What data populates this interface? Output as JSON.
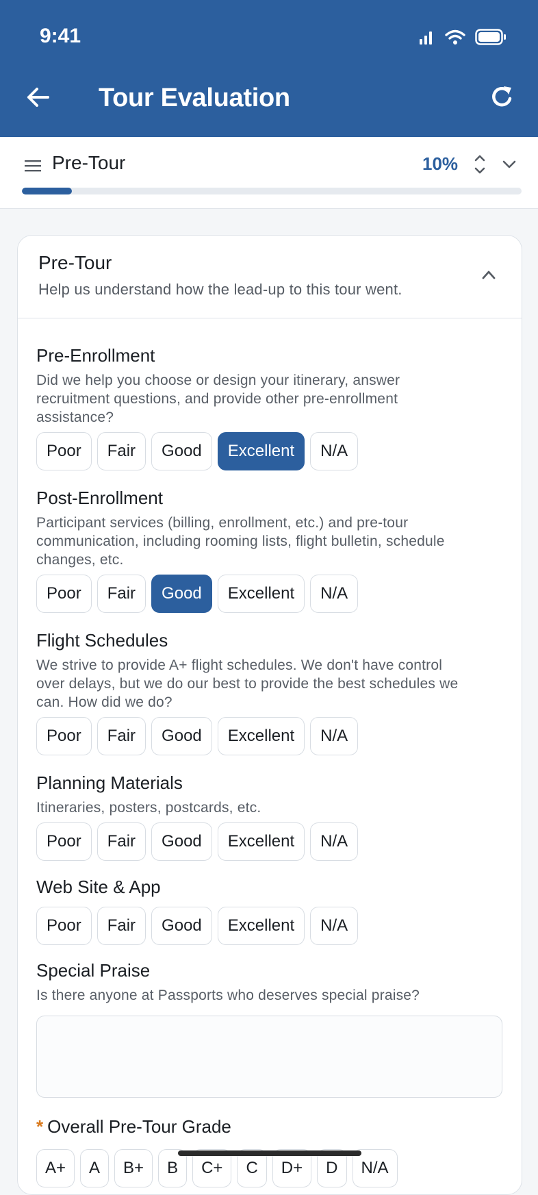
{
  "status": {
    "time": "9:41"
  },
  "header": {
    "title": "Tour Evaluation"
  },
  "section_bar": {
    "name": "Pre-Tour",
    "percent_label": "10%",
    "progress_fraction": 0.1
  },
  "card": {
    "title": "Pre-Tour",
    "subtitle": "Help us understand how the lead-up to this tour went."
  },
  "rating_options": [
    "Poor",
    "Fair",
    "Good",
    "Excellent",
    "N/A"
  ],
  "questions": [
    {
      "title": "Pre-Enrollment",
      "lines": [
        "Did we help you choose or design your itinerary, answer",
        "recruitment questions, and provide other pre-enrollment",
        "assistance?"
      ],
      "selected": "Excellent"
    },
    {
      "title": "Post-Enrollment",
      "lines": [
        "Participant services (billing, enrollment, etc.) and pre-tour",
        "communication, including rooming lists, flight bulletin, schedule",
        "changes, etc."
      ],
      "selected": "Good"
    },
    {
      "title": "Flight Schedules",
      "lines": [
        "We strive to provide A+ flight schedules. We don't have control",
        "over delays, but we do our best to provide the best schedules we",
        "can. How did we do?"
      ],
      "selected": ""
    },
    {
      "title": "Planning Materials",
      "lines": [
        "Itineraries, posters, postcards, etc."
      ],
      "selected": ""
    },
    {
      "title": "Web Site & App",
      "lines": [],
      "selected": ""
    }
  ],
  "praise": {
    "title": "Special Praise",
    "desc": "Is there anyone at Passports who deserves special praise?",
    "value": ""
  },
  "grade": {
    "required_mark": "*",
    "title": "Overall Pre-Tour Grade",
    "options": [
      "A+",
      "A",
      "B+",
      "B",
      "C+",
      "C",
      "D+",
      "D",
      "N/A"
    ]
  },
  "colors": {
    "brand": "#2c5f9e",
    "required": "#d97a1e"
  }
}
